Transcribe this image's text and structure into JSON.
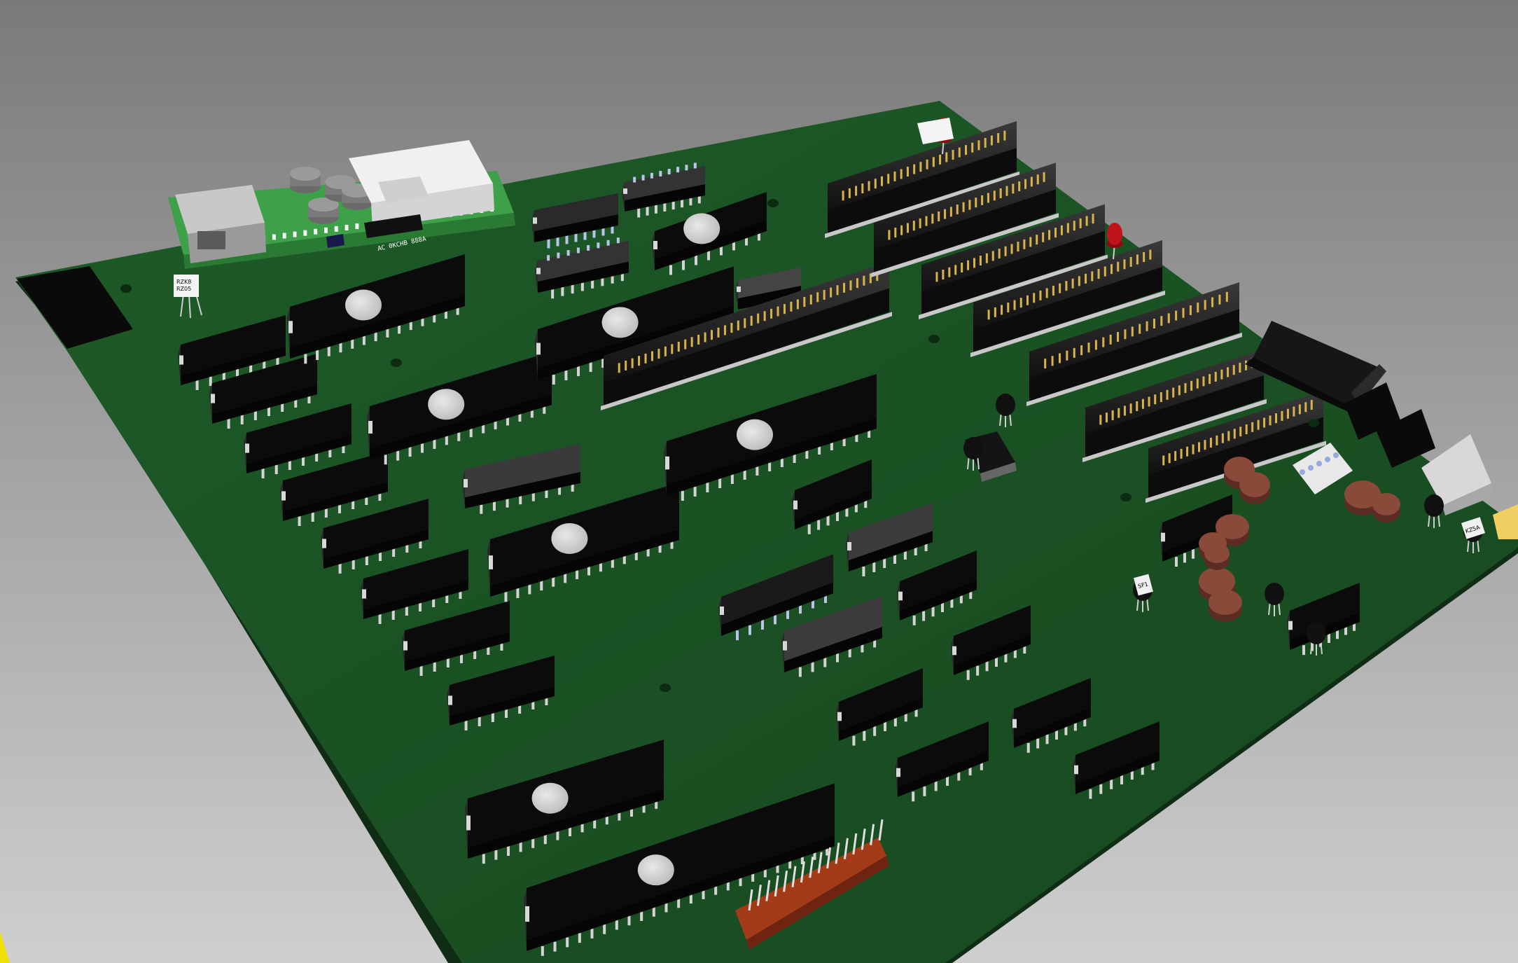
{
  "viewport": {
    "background_top": "#7d7d7d",
    "background_bottom": "#c9c9c9",
    "board_color": "#1f5a2a",
    "board_edge": "#0f2f15",
    "chip_color": "#0b0b0b",
    "pin_color": "#d4d4d4",
    "slot_pin_color": "#d9b34a",
    "resistor_color": "#8a4a3a",
    "led_color": "#c0141a",
    "yellow_corner": "#f0e000"
  },
  "module": {
    "label_text": "AC 0KCHB 888A"
  },
  "components": {
    "sensor_label": "RZK8\nRZ05",
    "regulator_label_1": "SF1",
    "regulator_label_2": "KZ5A",
    "eprom_label": ""
  }
}
